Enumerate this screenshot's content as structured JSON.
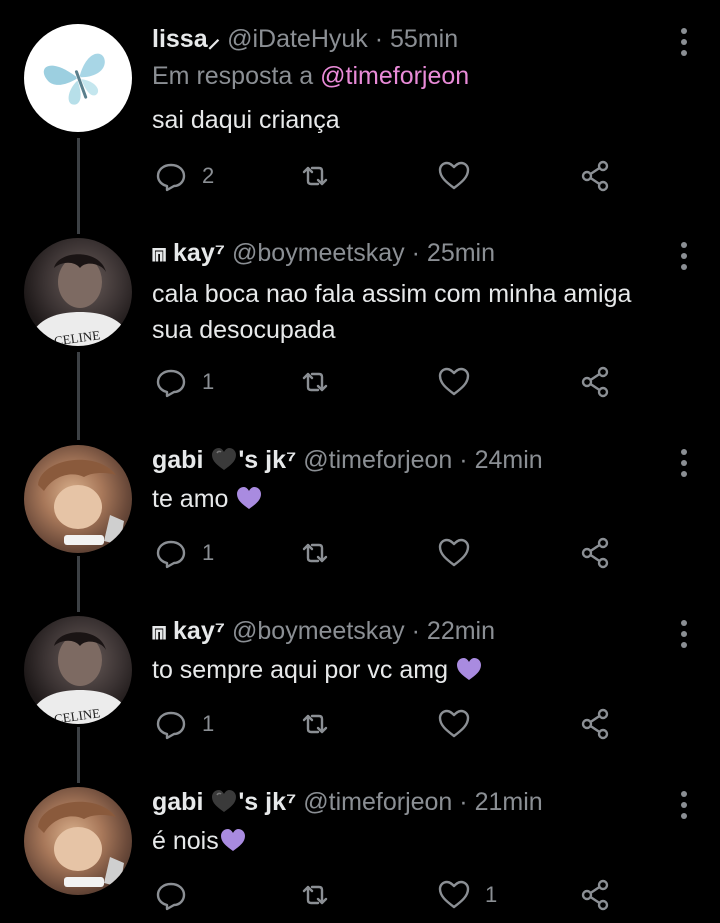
{
  "tweets": [
    {
      "name": "lissa",
      "name_suffix": "⸝",
      "handle": "@iDateHyuk",
      "time": "55min",
      "reply_prefix": "Em resposta a",
      "reply_mention": "@timeforjeon",
      "text": "sai daqui criança",
      "replies": "2",
      "retweets": "",
      "likes": ""
    },
    {
      "name": "⩎ kay⁷",
      "handle": "@boymeetskay",
      "time": "25min",
      "text_line1": "cala boca nao fala assim com minha amiga",
      "text_line2": "sua desocupada",
      "replies": "1",
      "retweets": "",
      "likes": ""
    },
    {
      "name": "gabi",
      "name_tail": "'s jk⁷",
      "handle": "@timeforjeon",
      "time": "24min",
      "text": "te amo",
      "replies": "1",
      "retweets": "",
      "likes": ""
    },
    {
      "name": "⩎ kay⁷",
      "handle": "@boymeetskay",
      "time": "22min",
      "text": "to sempre aqui por vc amg",
      "replies": "1",
      "retweets": "",
      "likes": ""
    },
    {
      "name": "gabi",
      "name_tail": "'s jk⁷",
      "handle": "@timeforjeon",
      "time": "21min",
      "text": "é nois",
      "replies": "",
      "retweets": "",
      "likes": "1"
    }
  ],
  "icons": [
    "butterfly-icon",
    "reply-icon",
    "retweet-icon",
    "like-icon",
    "share-icon",
    "more-icon",
    "purple-heart-emoji",
    "black-heart-emoji"
  ],
  "colors": {
    "background": "#000000",
    "text": "#e7e9ea",
    "muted": "#8b8f94",
    "mention": "#e98bd8",
    "purple_heart": "#a98be0"
  },
  "dot": "·",
  "avatar_text": {
    "celine": "CELINE"
  }
}
